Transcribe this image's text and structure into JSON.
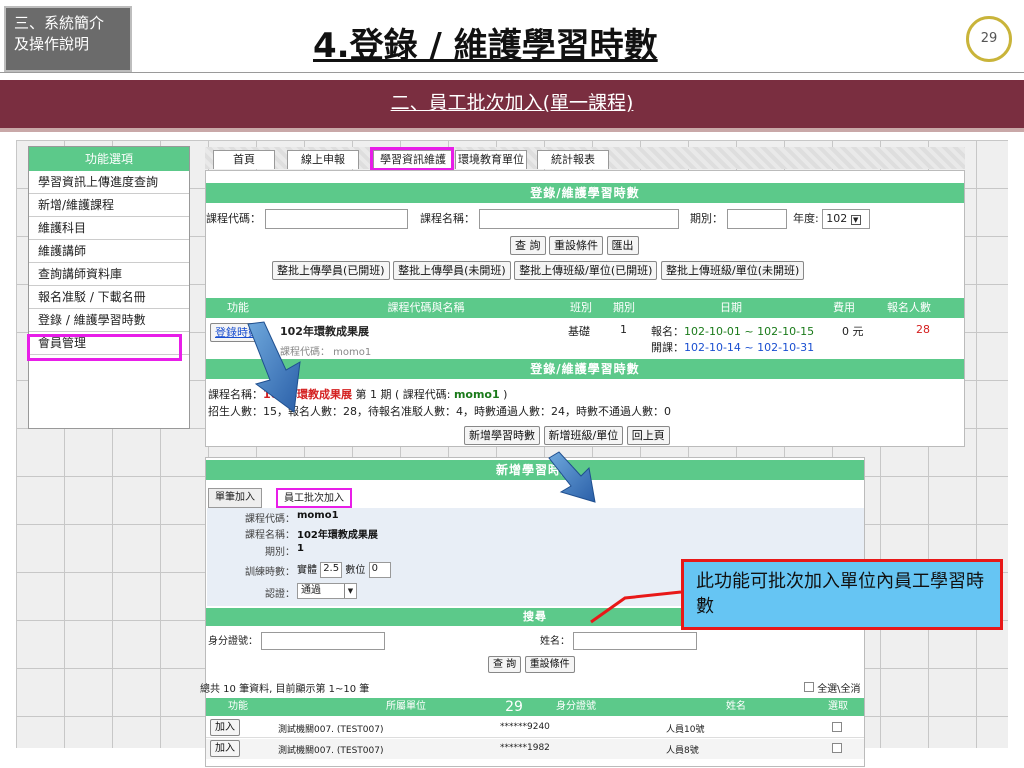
{
  "section": {
    "line1": "三、系統簡介",
    "line2": "及操作說明"
  },
  "slide_title": "4.登錄 / 維護學習時數",
  "page_number": "29",
  "banner": "二、員工批次加入(單一課程)",
  "menu": {
    "header": "功能選項",
    "items": [
      "學習資訊上傳進度查詢",
      "新增/維護課程",
      "維護科目",
      "維護講師",
      "查詢講師資料庫",
      "報名准駁 / 下載名冊",
      "登錄 / 維護學習時數",
      "會員管理"
    ]
  },
  "tabs": [
    "首頁",
    "線上申報",
    "學習資訊維護",
    "環境教育單位",
    "統計報表"
  ],
  "panel1": {
    "title": "登錄/維護學習時數",
    "course_code_label": "課程代碼：",
    "course_name_label": "課程名稱：",
    "period_label": "期別：",
    "year_label": "年度:",
    "year_value": "102",
    "query_btn": "查 詢",
    "reset_btn": "重設條件",
    "export_btn": "匯出",
    "batch_btns": [
      "整批上傳學員(已開班)",
      "整批上傳學員(未開班)",
      "整批上傳班級/單位(已開班)",
      "整批上傳班級/單位(未開班)"
    ],
    "headers": [
      "功能",
      "課程代碼與名稱",
      "班別",
      "期別",
      "日期",
      "費用",
      "報名人數"
    ],
    "row": {
      "action": "登錄時數",
      "course_name": "102年環教成果展",
      "course_code": "課程代碼： momo1",
      "class_type": "基礎",
      "period": "1",
      "signup_label": "報名：",
      "signup_range": "102-10-01 ~ 102-10-15",
      "open_label": "開課：",
      "open_range": "102-10-14 ~ 102-10-31",
      "fee": "0 元",
      "signup_count": "28"
    },
    "title2": "登錄/維護學習時數",
    "summary1_pre": "課程名稱：",
    "summary1_name": "102年環教成果展",
    "summary1_mid": " 第 1 期 ( 課程代碼: ",
    "summary1_code": "momo1",
    "summary1_end": " )",
    "summary2": "招生人數：15，報名人數：28，待報名准駁人數：4，時數通過人數：24，時數不通過人數：0",
    "add_hours_btn": "新增學習時數",
    "add_class_btn": "新增班級/單位",
    "back_btn": "回上頁"
  },
  "panel2": {
    "title": "新增學習時數",
    "subtabs": [
      "單筆加入",
      "員工批次加入"
    ],
    "code_label": "課程代碼：",
    "code_value": "momo1",
    "name_label": "課程名稱：",
    "name_value": "102年環教成果展",
    "period_label": "期別：",
    "period_value": "1",
    "hours_label": "訓練時數：",
    "hours_real_label": "實體",
    "hours_real_value": "2.5",
    "hours_digital_label": "數位",
    "hours_digital_value": "0",
    "cert_label": "認證：",
    "cert_value": "通過",
    "search_title": "搜尋",
    "id_label": "身分證號：",
    "person_label": "姓名：",
    "query_btn": "查 詢",
    "reset_btn": "重設條件",
    "total_text": "總共 10 筆資料, 目前顯示第 1~10 筆",
    "select_all": "全選\\全消",
    "headers": [
      "功能",
      "所屬單位",
      "身分證號",
      "姓名",
      "選取"
    ],
    "overlay_num": "29",
    "rows": [
      {
        "action": "加入",
        "unit": "測試機關007. (TEST007)",
        "id": "******9240",
        "name": "人員10號"
      },
      {
        "action": "加入",
        "unit": "測試機關007. (TEST007)",
        "id": "******1982",
        "name": "人員8號"
      }
    ]
  },
  "callout": "此功能可批次加入單位內員工學習時數"
}
